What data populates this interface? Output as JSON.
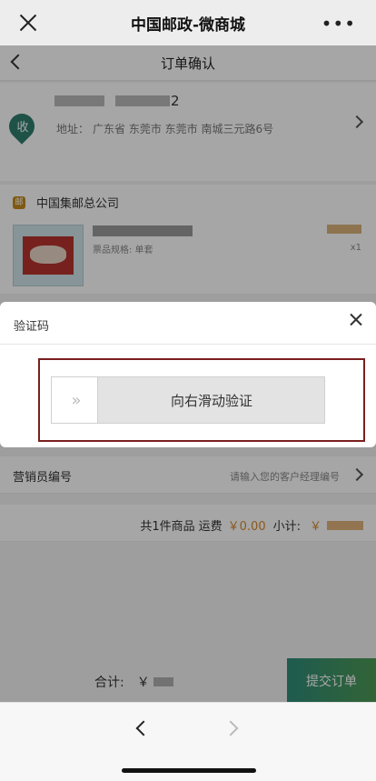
{
  "wechat": {
    "title": "中国邮政-微商城",
    "more": "•••"
  },
  "nav": {
    "title": "订单确认"
  },
  "address": {
    "name_tail": "2",
    "pin_label": "收",
    "label": "地址：",
    "detail": "广东省 东莞市 东莞市 南城三元路6号"
  },
  "shop": {
    "icon": "邮",
    "name": "中国集邮总公司",
    "spec": "票品规格: 单套",
    "qty": "x1"
  },
  "marketing": {
    "label": "营销员编号",
    "placeholder": "请输入您的客户经理编号"
  },
  "summary": {
    "count": "共1件商品",
    "freight_label": "运费",
    "freight": "￥0.00",
    "subtotal_label": "小计:",
    "subtotal_prefix": "￥"
  },
  "bottom": {
    "total_label": "合计:",
    "currency": "￥",
    "submit": "提交订单"
  },
  "captcha": {
    "title": "验证码",
    "slider_label": "向右滑动验证",
    "handle_glyph": "»"
  }
}
